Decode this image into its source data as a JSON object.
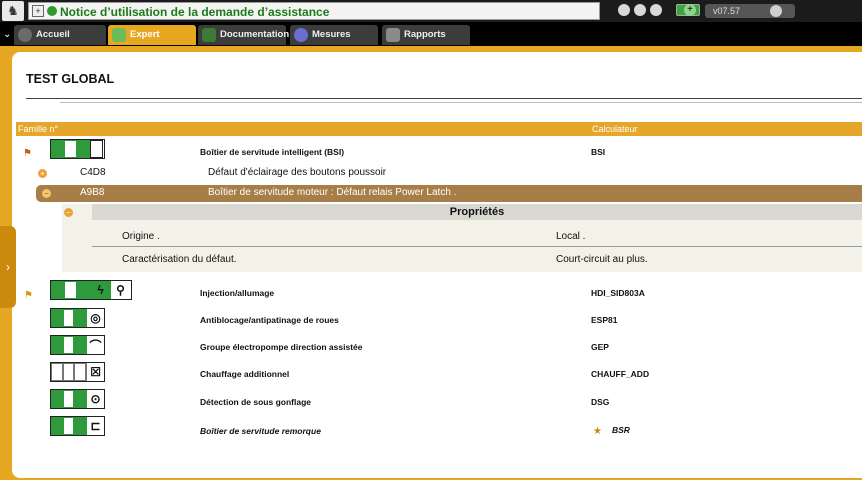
{
  "header": {
    "logo_icon": "peugeot-lion-icon",
    "help_title": "Notice d’utilisation de la demande d’assistance",
    "version": "v07.57"
  },
  "tabs": [
    {
      "label": "Accueil",
      "icon": "home-icon",
      "active": false
    },
    {
      "label": "Expert",
      "icon": "magnifier-icon",
      "active": true
    },
    {
      "label": "Documentation",
      "icon": "book-icon",
      "active": false
    },
    {
      "label": "Mesures",
      "icon": "waveform-icon",
      "active": false
    },
    {
      "label": "Rapports",
      "icon": "report-icon",
      "active": false
    }
  ],
  "page": {
    "title": "TEST GLOBAL",
    "columns": {
      "famille": "Famille n°",
      "calculateur": "Calculateur"
    }
  },
  "bsi": {
    "name": "Boîtier de servitude intelligent (BSI)",
    "calc": "BSI",
    "faults": [
      {
        "code": "C4D8",
        "description": "Défaut d'éclairage des boutons poussoir",
        "expanded": false
      },
      {
        "code": "A9B8",
        "description": "Boîtier de servitude moteur : Défaut relais Power Latch .",
        "expanded": true
      }
    ],
    "properties": {
      "title": "Propriétés",
      "rows": [
        {
          "key": "Origine .",
          "value": "Local ."
        },
        {
          "key": "Caractérisation du défaut.",
          "value": "Court-circuit au plus."
        }
      ]
    }
  },
  "ecus": [
    {
      "name": "Injection/allumage",
      "calc": "HDI_SID803A",
      "italic": false
    },
    {
      "name": "Antiblocage/antipatinage de roues",
      "calc": "ESP81",
      "italic": false
    },
    {
      "name": "Groupe électropompe direction assistée",
      "calc": "GEP",
      "italic": false
    },
    {
      "name": "Chauffage additionnel",
      "calc": "CHAUFF_ADD",
      "italic": false
    },
    {
      "name": "Détection de sous gonflage",
      "calc": "DSG",
      "italic": false
    },
    {
      "name": "Boîtier de servitude remorque",
      "calc": "BSR",
      "italic": true
    }
  ],
  "colors": {
    "accent": "#e7a721",
    "selected_row": "#a77e47",
    "ecu_green": "#2f9a3b"
  }
}
